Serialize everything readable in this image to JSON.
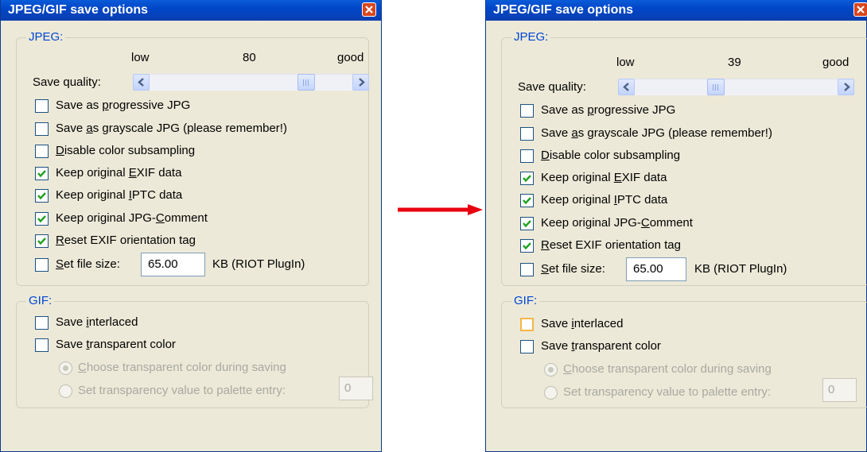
{
  "arrow_color": "#e8000f",
  "dialogs": [
    {
      "title": "JPEG/GIF save options",
      "jpeg_group": "JPEG:",
      "quality": {
        "low_label": "low",
        "value": "80",
        "good_label": "good",
        "save_quality_label": "Save quality:",
        "level": 80
      },
      "jpeg_options": [
        {
          "label": "Save as progressive JPG",
          "checked": false
        },
        {
          "label": "Save as grayscale JPG (please remember!)",
          "checked": false
        },
        {
          "label": "Disable color subsampling",
          "checked": false
        },
        {
          "label": "Keep original EXIF data",
          "checked": true
        },
        {
          "label": "Keep original IPTC data",
          "checked": true
        },
        {
          "label": "Keep original JPG-Comment",
          "checked": true
        },
        {
          "label": "Reset EXIF orientation tag",
          "checked": true
        }
      ],
      "file_size": {
        "label": "Set file size:",
        "value": "65.00",
        "unit": "KB (RIOT PlugIn)",
        "checked": false
      },
      "gif_group": "GIF:",
      "gif_options": [
        {
          "label": "Save interlaced",
          "checked": false
        },
        {
          "label": "Save transparent color",
          "checked": false
        }
      ],
      "radio_choose": "Choose transparent color during saving",
      "radio_set": "Set transparency value to palette entry:",
      "palette_value": "0"
    },
    {
      "title": "JPEG/GIF save options",
      "jpeg_group": "JPEG:",
      "quality": {
        "low_label": "low",
        "value": "39",
        "good_label": "good",
        "save_quality_label": "Save quality:",
        "level": 39
      },
      "jpeg_options": [
        {
          "label": "Save as progressive JPG",
          "checked": false
        },
        {
          "label": "Save as grayscale JPG (please remember!)",
          "checked": false
        },
        {
          "label": "Disable color subsampling",
          "checked": false
        },
        {
          "label": "Keep original EXIF data",
          "checked": true
        },
        {
          "label": "Keep original IPTC data",
          "checked": true
        },
        {
          "label": "Keep original JPG-Comment",
          "checked": true
        },
        {
          "label": "Reset EXIF orientation tag",
          "checked": true
        }
      ],
      "file_size": {
        "label": "Set file size:",
        "value": "65.00",
        "unit": "KB (RIOT PlugIn)",
        "checked": false
      },
      "gif_group": "GIF:",
      "gif_options": [
        {
          "label": "Save interlaced",
          "checked": false
        },
        {
          "label": "Save transparent color",
          "checked": false
        }
      ],
      "radio_choose": "Choose transparent color during saving",
      "radio_set": "Set transparency value to palette entry:",
      "palette_value": "0"
    }
  ]
}
